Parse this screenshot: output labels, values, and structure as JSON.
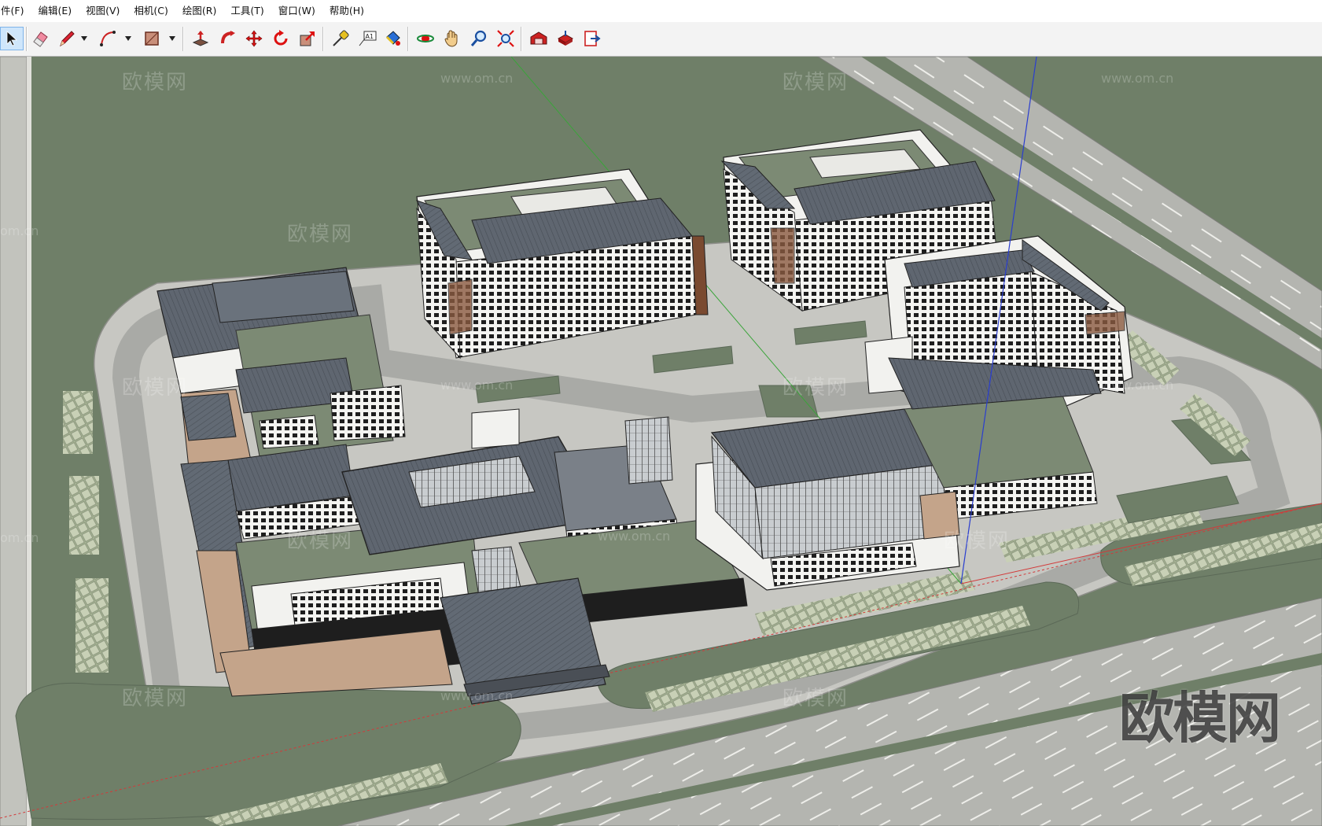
{
  "menu": [
    "件(F)",
    "编辑(E)",
    "视图(V)",
    "相机(C)",
    "绘图(R)",
    "工具(T)",
    "窗口(W)",
    "帮助(H)"
  ],
  "toolbar": {
    "tools": [
      "select-tool",
      "eraser-tool",
      "line-tool",
      "arc-tool",
      "shape-tool",
      "push-pull-tool",
      "follow-me-tool",
      "move-tool",
      "rotate-tool",
      "scale-tool",
      "tape-measure-tool",
      "text-tool",
      "paint-bucket-tool",
      "orbit-tool",
      "pan-tool",
      "zoom-tool",
      "zoom-extents-tool",
      "warehouse-tool",
      "share-model-tool",
      "extension-tool"
    ],
    "text_tool_label": "A1"
  },
  "watermarks": {
    "brand": "欧模网",
    "url": "www.om.cn",
    "url_fragment": "om.cn"
  },
  "colors": {
    "grass": "#6f7f68",
    "pavement": "#c7c7c2",
    "road": "#a9aaa6",
    "roof": "#5f6670",
    "wall": "#f2f2ef",
    "axis_red": "#d23a3a",
    "axis_green": "#3aa43a",
    "axis_blue": "#2a3ed0"
  }
}
